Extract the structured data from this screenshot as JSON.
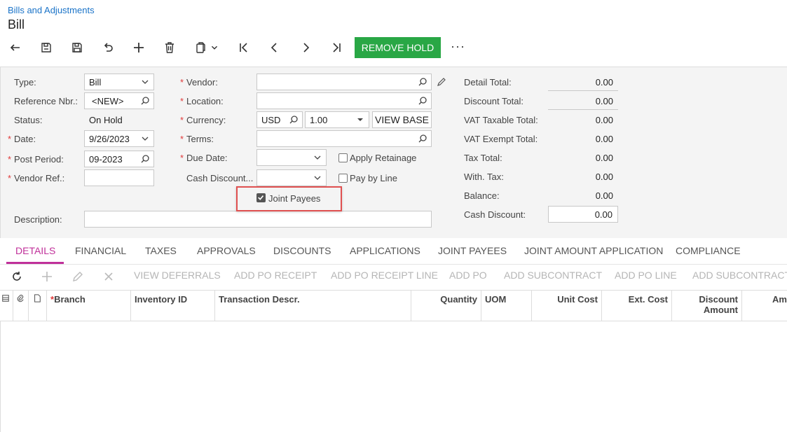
{
  "breadcrumb": "Bills and Adjustments",
  "page_title": "Bill",
  "toolbar": {
    "remove_hold": "REMOVE HOLD",
    "more": "···"
  },
  "form": {
    "type_label": "Type:",
    "type_value": "Bill",
    "refnbr_label": "Reference Nbr.:",
    "refnbr_value": "<NEW>",
    "status_label": "Status:",
    "status_value": "On Hold",
    "date_label": "Date:",
    "date_value": "9/26/2023",
    "postperiod_label": "Post Period:",
    "postperiod_value": "09-2023",
    "vendorref_label": "Vendor Ref.:",
    "vendorref_value": "",
    "description_label": "Description:",
    "description_value": "",
    "vendor_label": "Vendor:",
    "vendor_value": "",
    "location_label": "Location:",
    "location_value": "",
    "currency_label": "Currency:",
    "currency_code": "USD",
    "currency_rate": "1.00",
    "view_base": "VIEW BASE",
    "terms_label": "Terms:",
    "terms_value": "",
    "duedate_label": "Due Date:",
    "duedate_value": "",
    "cashdisc_label": "Cash Discount...",
    "cashdisc_value": "",
    "apply_retainage": "Apply Retainage",
    "pay_by_line": "Pay by Line",
    "joint_payees": "Joint Payees"
  },
  "totals": [
    {
      "label": "Detail Total:",
      "value": "0.00"
    },
    {
      "label": "Discount Total:",
      "value": "0.00"
    },
    {
      "label": "VAT Taxable Total:",
      "value": "0.00"
    },
    {
      "label": "VAT Exempt Total:",
      "value": "0.00"
    },
    {
      "label": "Tax Total:",
      "value": "0.00"
    },
    {
      "label": "With. Tax:",
      "value": "0.00"
    },
    {
      "label": "Balance:",
      "value": "0.00"
    },
    {
      "label": "Cash Discount:",
      "value": "0.00"
    }
  ],
  "tabs": [
    "DETAILS",
    "FINANCIAL",
    "TAXES",
    "APPROVALS",
    "DISCOUNTS",
    "APPLICATIONS",
    "JOINT PAYEES",
    "JOINT AMOUNT APPLICATION",
    "COMPLIANCE"
  ],
  "grid_toolbar": [
    "VIEW DEFERRALS",
    "ADD PO RECEIPT",
    "ADD PO RECEIPT LINE",
    "ADD PO",
    "ADD SUBCONTRACT",
    "ADD PO LINE",
    "ADD SUBCONTRACT L"
  ],
  "columns": {
    "branch": "Branch",
    "inventory": "Inventory ID",
    "descr": "Transaction Descr.",
    "qty": "Quantity",
    "uom": "UOM",
    "unitcost": "Unit Cost",
    "extcost": "Ext. Cost",
    "disc1": "Discount",
    "disc2": "Amount",
    "am": "Am"
  },
  "colors": {
    "accent": "#29a745",
    "active_tab": "#c0309a",
    "highlight": "#e05050",
    "link": "#1a73c8"
  }
}
